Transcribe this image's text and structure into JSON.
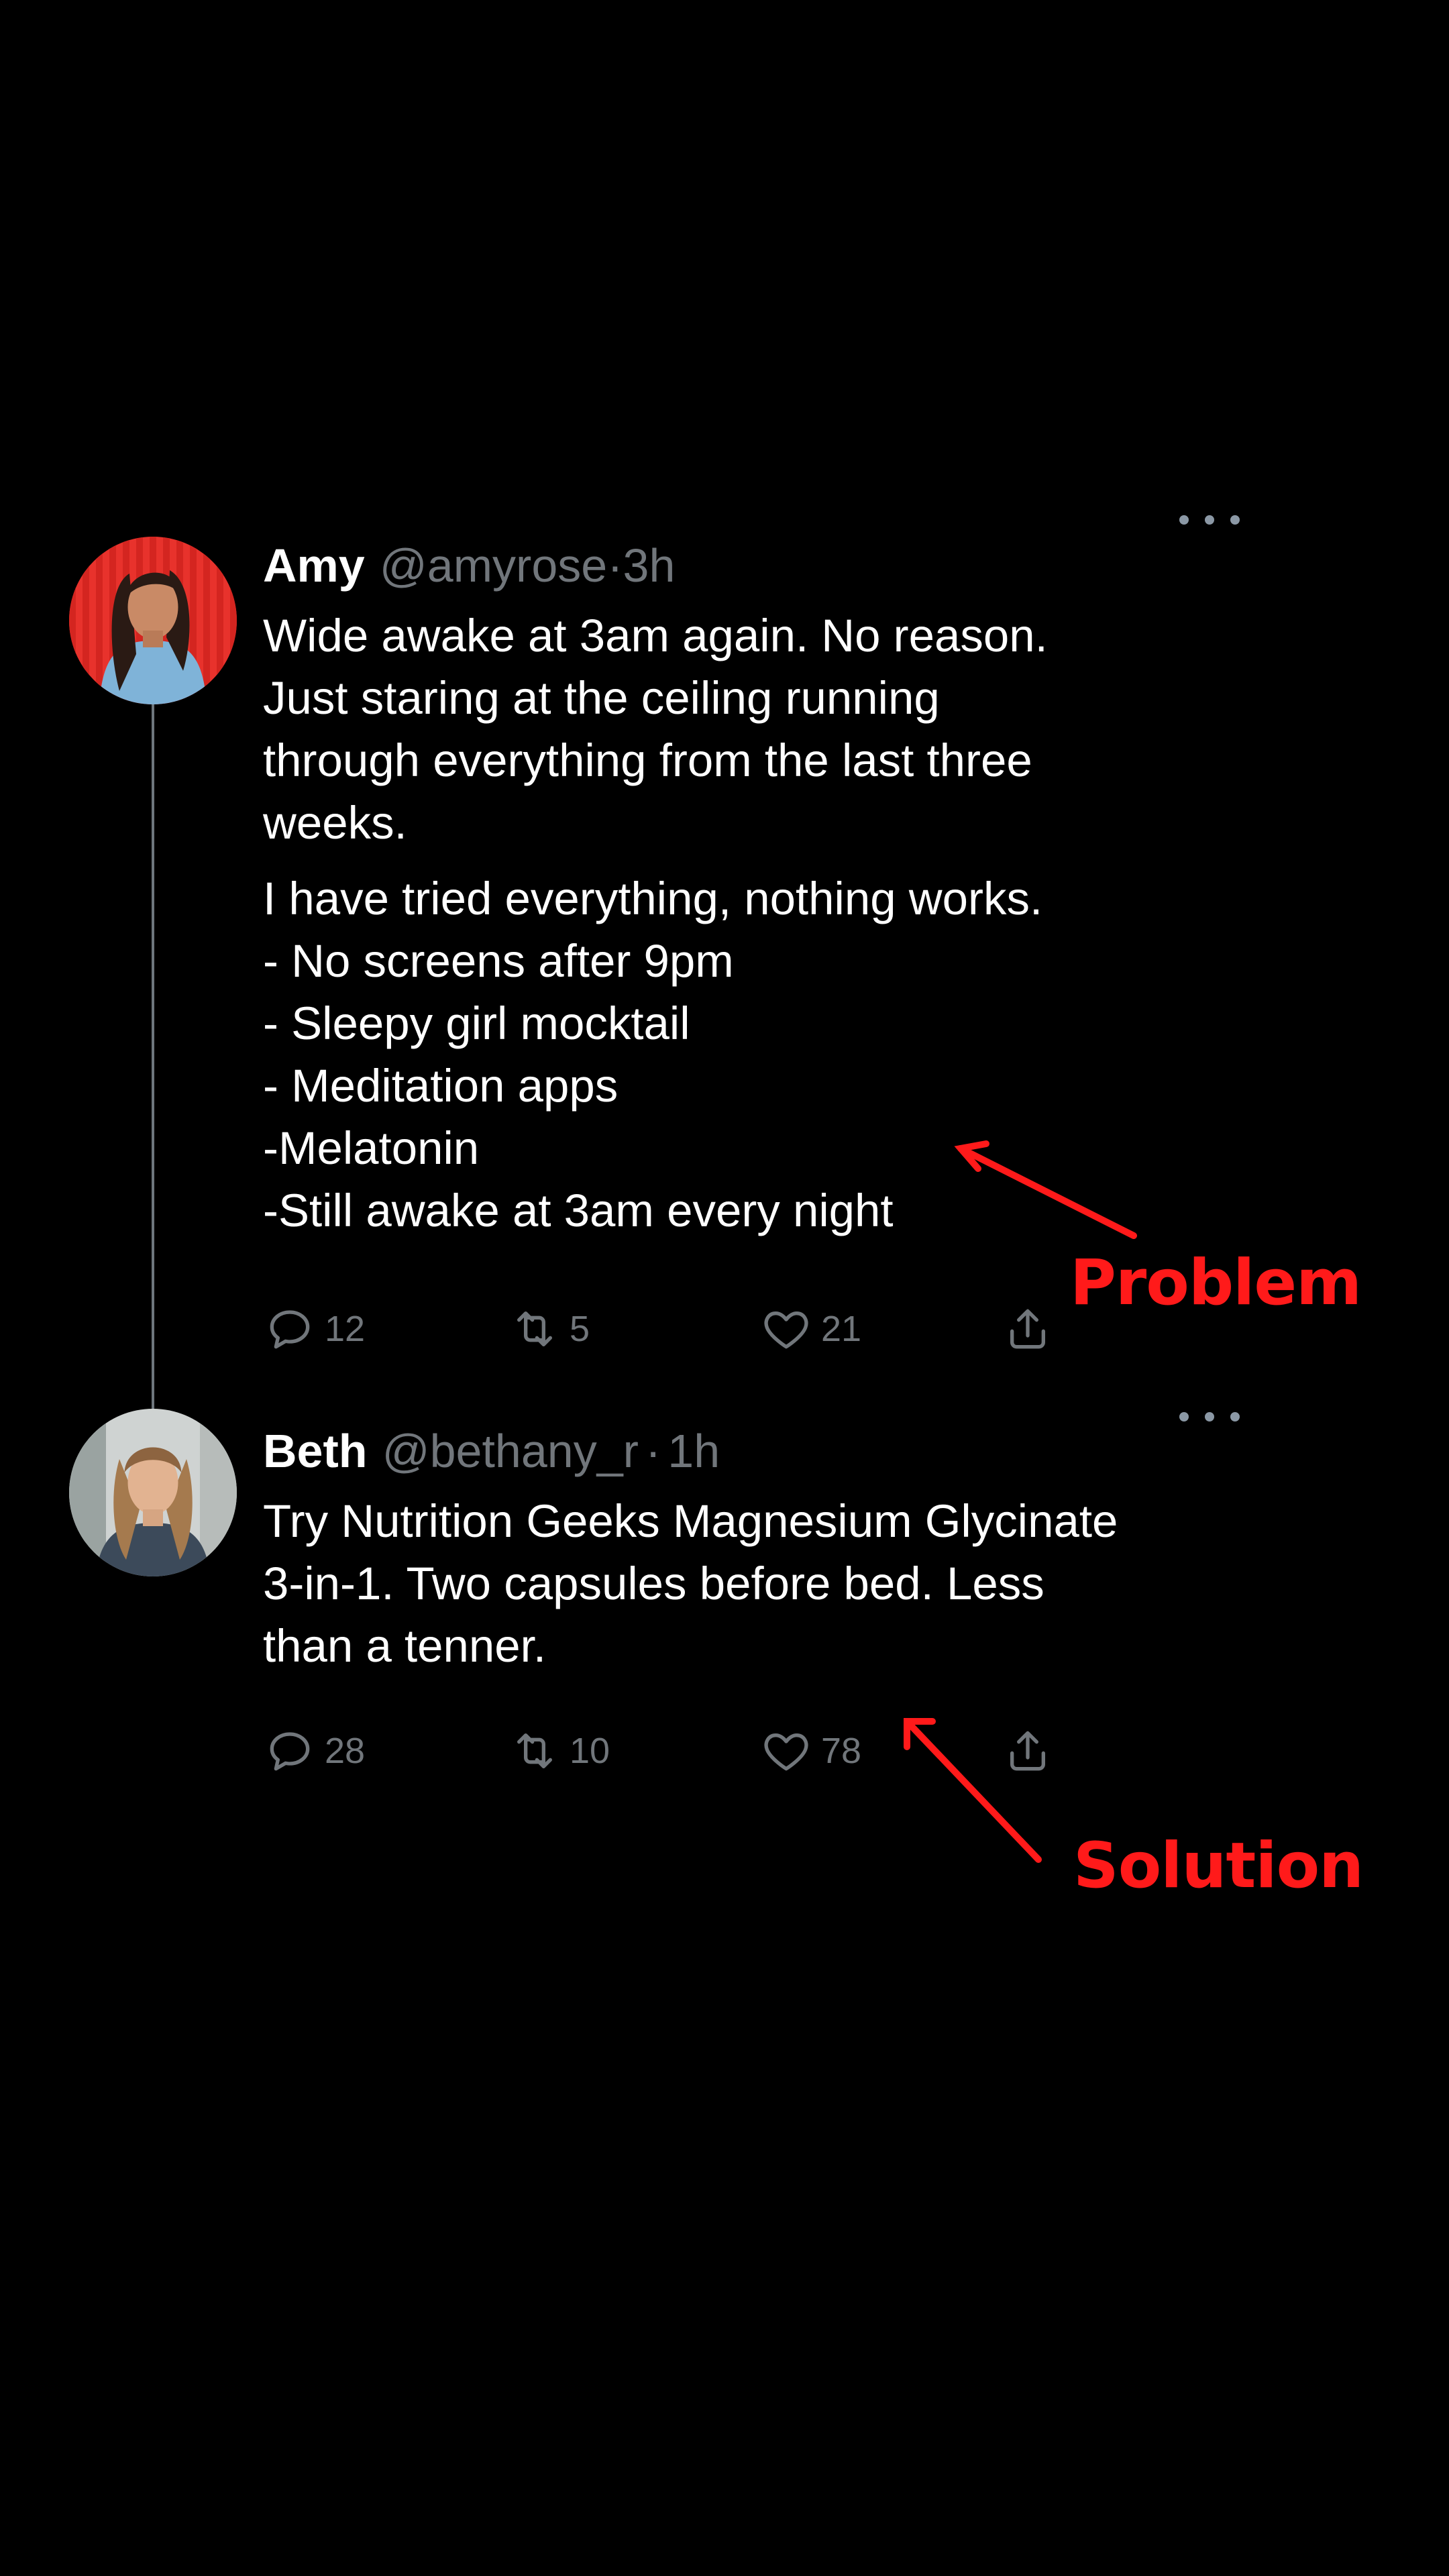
{
  "tweets": [
    {
      "name": "Amy",
      "handle": "@amyrose",
      "time": "·3h",
      "paragraphs": [
        "Wide awake at 3am again. No reason.\nJust staring at the ceiling running\nthrough everything from the last three\nweeks.",
        "I have tried everything, nothing works.\n- No screens after 9pm\n- Sleepy girl mocktail\n- Meditation apps\n-Melatonin\n-Still awake at 3am every night"
      ],
      "replies": "12",
      "retweets": "5",
      "likes": "21"
    },
    {
      "name": "Beth",
      "handle": "@bethany_r",
      "separator": "·",
      "time": "1h",
      "paragraphs": [
        "Try Nutrition Geeks Magnesium Glycinate\n3-in-1. Two capsules before bed. Less\nthan a tenner."
      ],
      "replies": "28",
      "retweets": "10",
      "likes": "78"
    }
  ],
  "annotations": {
    "problem": "Problem",
    "solution": "Solution",
    "color": "#ff1a1a"
  },
  "icons": {
    "reply": "reply-icon",
    "retweet": "retweet-icon",
    "like": "heart-icon",
    "share": "share-icon",
    "more": "more-icon"
  },
  "colors": {
    "background": "#000000",
    "text": "#ffffff",
    "muted": "#71767b"
  }
}
